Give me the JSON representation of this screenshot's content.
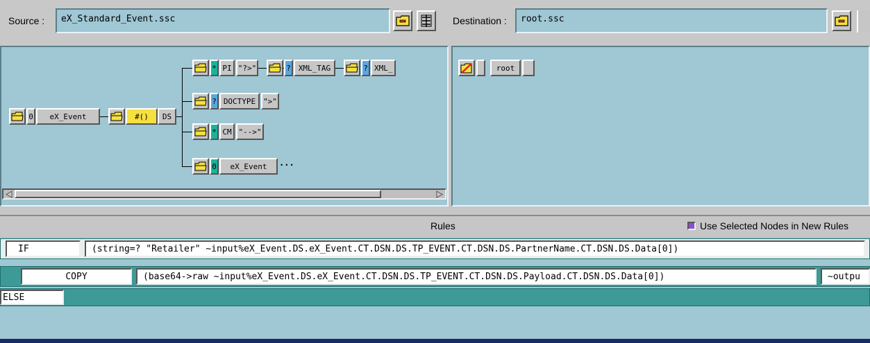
{
  "source": {
    "label": "Source :",
    "value": "eX_Standard_Event.ssc"
  },
  "destination": {
    "label": "Destination :",
    "value": "root.ssc"
  },
  "source_tree": {
    "root": {
      "type": "0",
      "name": "eX_Event"
    },
    "ds": {
      "type": "#()",
      "name": "DS"
    },
    "branches": [
      {
        "nodes": [
          {
            "type": "*",
            "name": "PI"
          },
          {
            "name": "\"?>\""
          },
          {
            "type": "?",
            "name": "XML_TAG"
          },
          {
            "type": "?",
            "name": "XML_"
          }
        ]
      },
      {
        "nodes": [
          {
            "type": "?",
            "name": "DOCTYPE"
          },
          {
            "name": "\">\""
          }
        ]
      },
      {
        "nodes": [
          {
            "type": "*",
            "name": "CM"
          },
          {
            "name": "\"-->\""
          }
        ]
      },
      {
        "nodes": [
          {
            "type": "0",
            "name": "eX_Event"
          },
          {
            "name": "···"
          }
        ]
      }
    ]
  },
  "dest_tree": {
    "root": {
      "name": "root"
    }
  },
  "rules": {
    "title": "Rules",
    "checkbox_label": "Use Selected Nodes in New Rules",
    "rows": [
      {
        "keyword": "IF",
        "expr": "(string=? \"Retailer\" ~input%eX_Event.DS.eX_Event.CT.DSN.DS.TP_EVENT.CT.DSN.DS.PartnerName.CT.DSN.DS.Data[0])"
      },
      {
        "keyword": "COPY",
        "expr": "(base64->raw ~input%eX_Event.DS.eX_Event.CT.DSN.DS.TP_EVENT.CT.DSN.DS.Payload.CT.DSN.DS.Data[0])",
        "expr2": "~outpu"
      },
      {
        "keyword": "ELSE"
      }
    ]
  },
  "colors": {
    "pane": "#9fc7d4",
    "rule_row": "#3d9a96",
    "chrome": "#c6c6c6",
    "star_badge": "#1ab39b",
    "question_badge": "#5aa7e0",
    "ds_badge": "#f5e040"
  }
}
